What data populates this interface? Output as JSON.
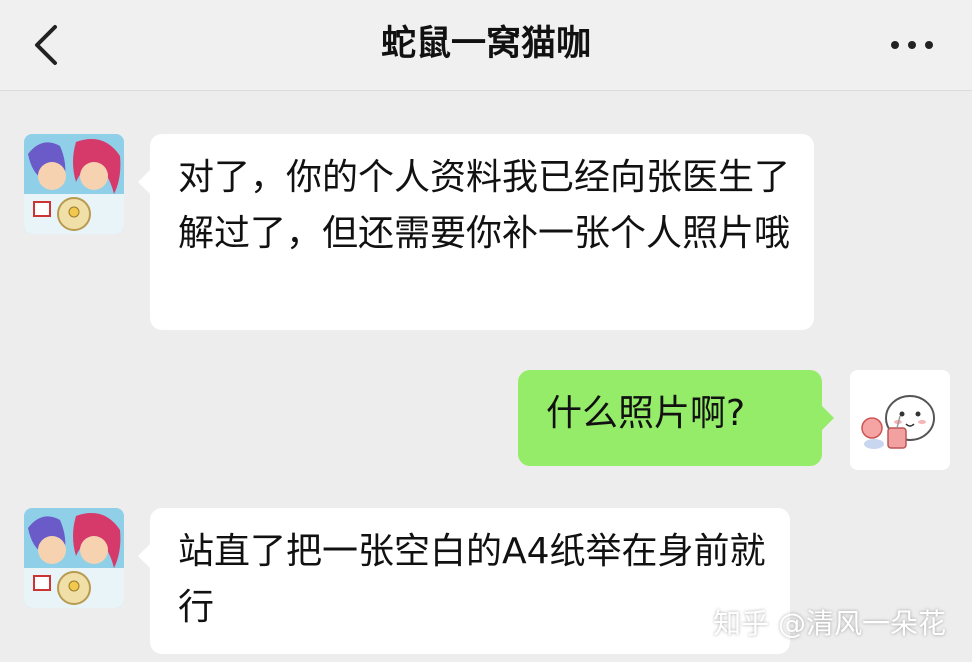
{
  "header": {
    "title": "蛇鼠一窝猫咖",
    "back_icon": "chevron-left-icon",
    "more_icon": "more-dots-icon"
  },
  "messages": [
    {
      "sender": "other",
      "text": "对了，你的个人资料我已经向张医生了解过了，但还需要你补一张个人照片哦"
    },
    {
      "sender": "self",
      "text": "什么照片啊?"
    },
    {
      "sender": "other",
      "text": "站直了把一张空白的A4纸举在身前就行"
    }
  ],
  "watermark": "知乎 @清风一朵花",
  "colors": {
    "incoming_bubble": "#ffffff",
    "outgoing_bubble": "#95ec69",
    "background": "#ededed"
  }
}
